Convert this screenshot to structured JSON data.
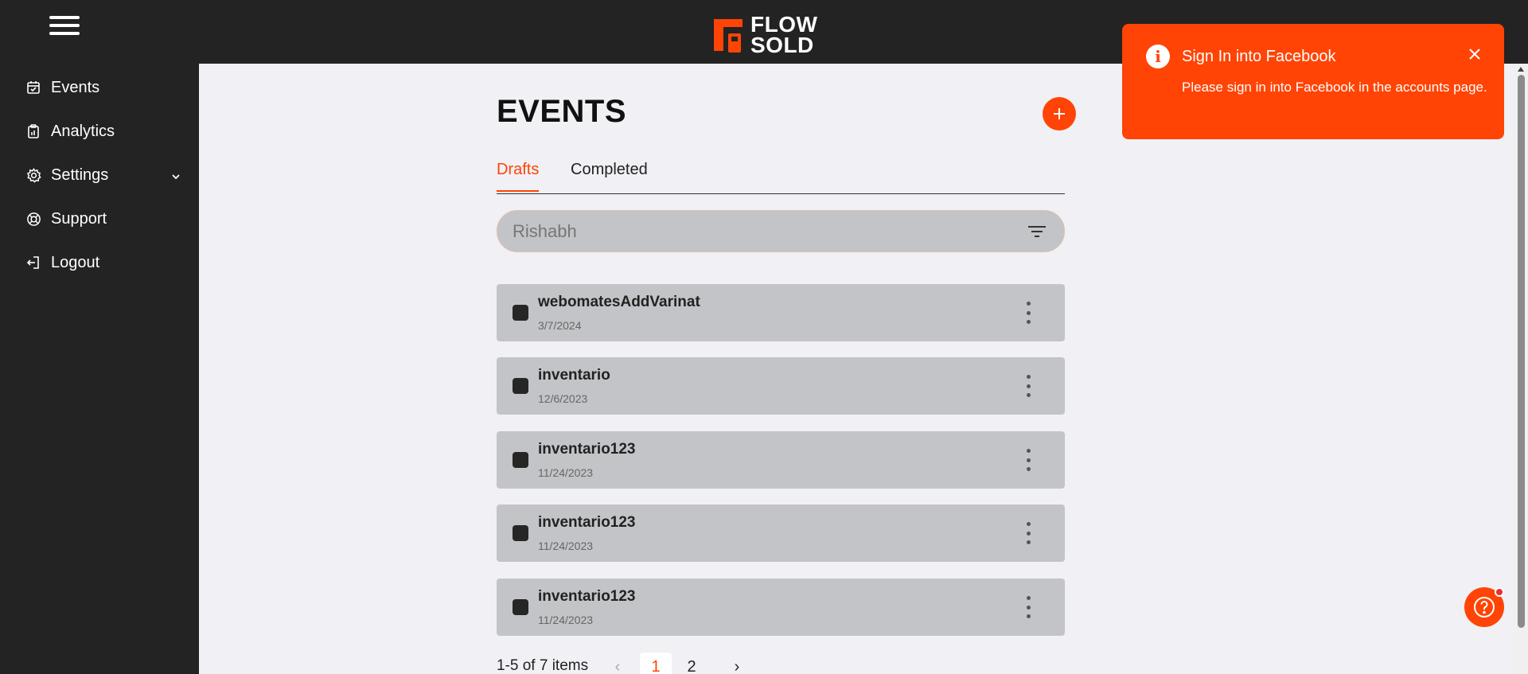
{
  "app": {
    "logo_line1": "FLOW",
    "logo_line2": "SOLD",
    "brand_color": "#ff4405"
  },
  "sidebar": {
    "items": [
      {
        "label": "Events",
        "icon": "calendar-check-icon"
      },
      {
        "label": "Analytics",
        "icon": "clipboard-chart-icon"
      },
      {
        "label": "Settings",
        "icon": "gear-icon",
        "expandable": true
      },
      {
        "label": "Support",
        "icon": "lifebuoy-icon"
      },
      {
        "label": "Logout",
        "icon": "logout-icon"
      }
    ]
  },
  "main": {
    "title": "EVENTS",
    "tabs": [
      {
        "label": "Drafts",
        "active": true
      },
      {
        "label": "Completed",
        "active": false
      }
    ],
    "search": {
      "value": "Rishabh",
      "placeholder": ""
    },
    "events": [
      {
        "name": "webomatesAddVarinat",
        "date": "3/7/2024"
      },
      {
        "name": "inventario",
        "date": "12/6/2023"
      },
      {
        "name": "inventario123",
        "date": "11/24/2023"
      },
      {
        "name": "inventario123",
        "date": "11/24/2023"
      },
      {
        "name": "inventario123",
        "date": "11/24/2023"
      }
    ],
    "pagination": {
      "summary": "1-5 of 7 items",
      "pages": [
        "1",
        "2"
      ],
      "current": "1"
    }
  },
  "toast": {
    "title": "Sign In into Facebook",
    "message": "Please sign in into Facebook in the accounts page."
  }
}
